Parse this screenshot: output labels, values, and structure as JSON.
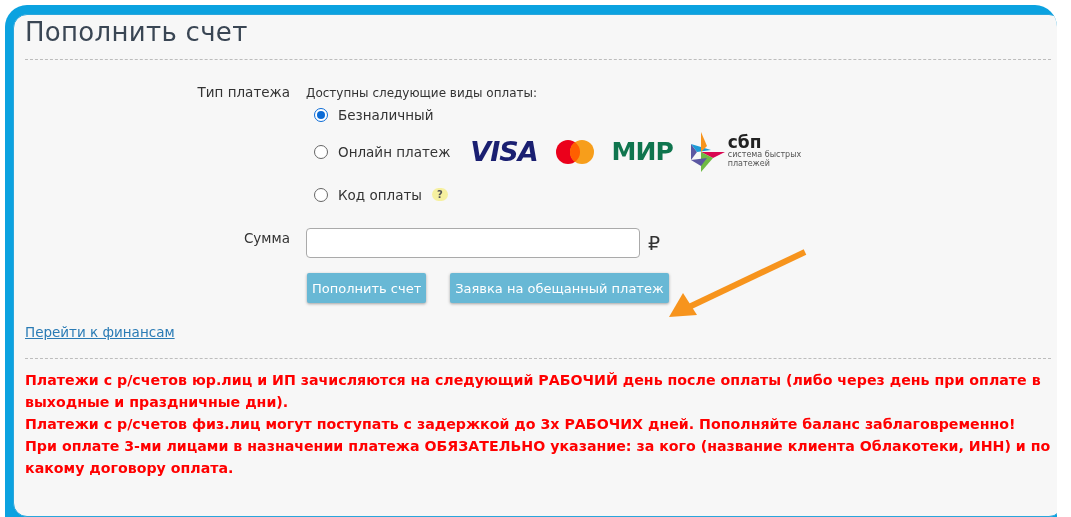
{
  "title": "Пополнить счет",
  "payment_type": {
    "label": "Тип платежа",
    "hint": "Доступны следующие виды оплаты:",
    "options": [
      {
        "label": "Безналичный",
        "selected": true,
        "kind": "plain"
      },
      {
        "label": "Онлайн платеж",
        "selected": false,
        "kind": "logos",
        "logos": {
          "visa": "VISA",
          "mir": "МИР",
          "sbp": "сбп",
          "sbp_caption": "система быстрых платежей"
        }
      },
      {
        "label": "Код оплаты",
        "selected": false,
        "kind": "help",
        "help": "?"
      }
    ]
  },
  "amount": {
    "label": "Сумма",
    "currency": "₽"
  },
  "buttons": [
    "Пополнить счет",
    "Заявка на обещанный платеж"
  ],
  "link": "Перейти к финансам",
  "notices": [
    "Платежи с р/счетов юр.лиц и ИП зачисляются на следующий РАБОЧИЙ день после оплаты (либо через день при оплате в выходные и праздничные дни).",
    "Платежи с р/счетов физ.лиц могут поступать с задержкой до 3х РАБОЧИХ дней. Пополняйте баланс заблаговременно!",
    "При оплате 3-ми лицами в назначении платежа ОБЯЗАТЕЛЬНО указание: за кого (название клиента Облакотеки, ИНН) и по какому договору оплата."
  ]
}
